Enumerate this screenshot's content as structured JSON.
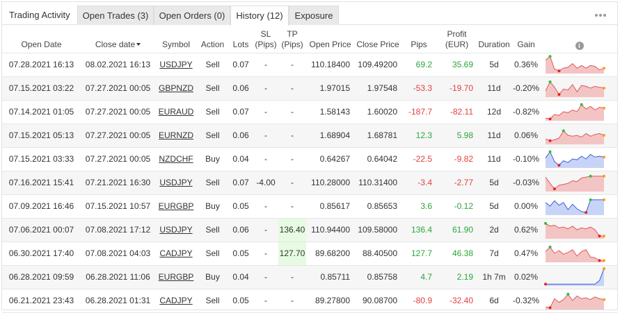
{
  "header": {
    "title": "Trading Activity",
    "tabs": [
      {
        "label": "Open Trades (3)",
        "active": false
      },
      {
        "label": "Open Orders (0)",
        "active": false
      },
      {
        "label": "History (12)",
        "active": true
      },
      {
        "label": "Exposure",
        "active": false
      }
    ],
    "more_icon": "ellipsis-icon"
  },
  "table": {
    "columns": {
      "open_date": "Open Date",
      "close_date": "Close date",
      "symbol": "Symbol",
      "action": "Action",
      "lots": "Lots",
      "sl_1": "SL",
      "sl_2": "(Pips)",
      "tp_1": "TP",
      "tp_2": "(Pips)",
      "open_price": "Open Price",
      "close_price": "Close Price",
      "pips": "Pips",
      "profit_1": "Profit",
      "profit_2": "(EUR)",
      "duration": "Duration",
      "gain": "Gain",
      "info_icon": "info-icon"
    },
    "rows": [
      {
        "open_date": "07.28.2021 16:13",
        "close_date": "08.02.2021 16:13",
        "symbol": "USDJPY",
        "action": "Sell",
        "lots": "0.07",
        "sl": "-",
        "tp": "-",
        "open_price": "110.18400",
        "close_price": "109.49200",
        "pips": "69.2",
        "profit": "35.69",
        "duration": "5d",
        "gain": "0.36%",
        "trend": "pos",
        "tp_hl": false,
        "spark": {
          "color": "red",
          "values": [
            0.75,
            0.95,
            0.25,
            0.15,
            0.3,
            0.35,
            0.55,
            0.3,
            0.45,
            0.3,
            0.45,
            0.4,
            0.2,
            0.3
          ]
        }
      },
      {
        "open_date": "07.15.2021 03:22",
        "close_date": "07.27.2021 00:05",
        "symbol": "GBPNZD",
        "action": "Sell",
        "lots": "0.06",
        "sl": "-",
        "tp": "-",
        "open_price": "1.97015",
        "close_price": "1.97548",
        "pips": "-53.3",
        "profit": "-19.70",
        "duration": "11d",
        "gain": "-0.20%",
        "trend": "neg",
        "tp_hl": false,
        "spark": {
          "color": "red",
          "values": [
            0.35,
            0.85,
            0.55,
            0.15,
            0.45,
            0.4,
            0.7,
            0.3,
            0.65,
            0.6,
            0.5,
            0.6,
            0.55,
            0.5
          ]
        }
      },
      {
        "open_date": "07.14.2021 01:05",
        "close_date": "07.27.2021 00:05",
        "symbol": "EURAUD",
        "action": "Sell",
        "lots": "0.07",
        "sl": "-",
        "tp": "-",
        "open_price": "1.58143",
        "close_price": "1.60020",
        "pips": "-187.7",
        "profit": "-82.11",
        "duration": "12d",
        "gain": "-0.82%",
        "trend": "neg",
        "tp_hl": false,
        "spark": {
          "color": "red",
          "values": [
            0.15,
            0.1,
            0.35,
            0.3,
            0.5,
            0.45,
            0.6,
            0.5,
            0.9,
            0.65,
            0.8,
            0.6,
            0.75,
            0.7
          ]
        }
      },
      {
        "open_date": "07.15.2021 05:13",
        "close_date": "07.27.2021 00:05",
        "symbol": "EURNZD",
        "action": "Sell",
        "lots": "0.06",
        "sl": "-",
        "tp": "-",
        "open_price": "1.68904",
        "close_price": "1.68781",
        "pips": "12.3",
        "profit": "5.98",
        "duration": "11d",
        "gain": "0.06%",
        "trend": "pos",
        "tp_hl": false,
        "spark": {
          "color": "red",
          "values": [
            0.3,
            0.2,
            0.25,
            0.35,
            0.75,
            0.5,
            0.45,
            0.5,
            0.4,
            0.6,
            0.45,
            0.55,
            0.6,
            0.5
          ]
        }
      },
      {
        "open_date": "07.15.2021 03:33",
        "close_date": "07.27.2021 00:05",
        "symbol": "NZDCHF",
        "action": "Buy",
        "lots": "0.04",
        "sl": "-",
        "tp": "-",
        "open_price": "0.64267",
        "close_price": "0.64042",
        "pips": "-22.5",
        "profit": "-9.82",
        "duration": "11d",
        "gain": "-0.10%",
        "trend": "neg",
        "tp_hl": false,
        "spark": {
          "color": "blue",
          "values": [
            0.55,
            0.9,
            0.35,
            0.15,
            0.4,
            0.3,
            0.5,
            0.45,
            0.65,
            0.5,
            0.75,
            0.6,
            0.65,
            0.6
          ]
        }
      },
      {
        "open_date": "07.16.2021 15:41",
        "close_date": "07.21.2021 16:30",
        "symbol": "USDJPY",
        "action": "Sell",
        "lots": "0.07",
        "sl": "-4.00",
        "tp": "-",
        "open_price": "110.28000",
        "close_price": "110.31400",
        "pips": "-3.4",
        "profit": "-2.77",
        "duration": "5d",
        "gain": "-0.03%",
        "trend": "neg",
        "tp_hl": false,
        "spark": {
          "color": "red",
          "values": [
            0.8,
            0.45,
            0.15,
            0.35,
            0.4,
            0.45,
            0.6,
            0.55,
            0.75,
            0.8,
            0.85,
            0.85,
            0.85,
            0.85
          ]
        }
      },
      {
        "open_date": "07.09.2021 16:46",
        "close_date": "07.15.2021 10:57",
        "symbol": "EURGBP",
        "action": "Buy",
        "lots": "0.05",
        "sl": "-",
        "tp": "-",
        "open_price": "0.85617",
        "close_price": "0.85653",
        "pips": "3.6",
        "profit": "-0.12",
        "duration": "5d",
        "gain": "0.00%",
        "trend": "pos",
        "tp_hl": false,
        "spark": {
          "color": "blue",
          "values": [
            0.7,
            0.5,
            0.8,
            0.55,
            0.7,
            0.3,
            0.6,
            0.35,
            0.2,
            0.15,
            0.85,
            0.85,
            0.85,
            0.85
          ]
        }
      },
      {
        "open_date": "07.06.2021 00:07",
        "close_date": "07.08.2021 17:12",
        "symbol": "USDJPY",
        "action": "Sell",
        "lots": "0.06",
        "sl": "-",
        "tp": "136.40",
        "open_price": "110.94400",
        "close_price": "109.58000",
        "pips": "136.4",
        "profit": "61.90",
        "duration": "2d",
        "gain": "0.62%",
        "trend": "pos",
        "tp_hl": true,
        "spark": {
          "color": "red",
          "values": [
            0.85,
            0.7,
            0.75,
            0.6,
            0.65,
            0.55,
            0.7,
            0.5,
            0.6,
            0.55,
            0.65,
            0.5,
            0.15,
            0.15
          ]
        }
      },
      {
        "open_date": "06.30.2021 17:40",
        "close_date": "07.08.2021 04:03",
        "symbol": "CADJPY",
        "action": "Sell",
        "lots": "0.05",
        "sl": "-",
        "tp": "127.70",
        "open_price": "89.68200",
        "close_price": "88.40500",
        "pips": "127.7",
        "profit": "46.38",
        "duration": "7d",
        "gain": "0.47%",
        "trend": "pos",
        "tp_hl": true,
        "spark": {
          "color": "red",
          "values": [
            0.6,
            0.85,
            0.5,
            0.65,
            0.45,
            0.55,
            0.7,
            0.35,
            0.6,
            0.7,
            0.3,
            0.25,
            0.1,
            0.1
          ]
        }
      },
      {
        "open_date": "06.28.2021 09:59",
        "close_date": "06.28.2021 11:06",
        "symbol": "EURGBP",
        "action": "Buy",
        "lots": "0.04",
        "sl": "-",
        "tp": "-",
        "open_price": "0.85711",
        "close_price": "0.85758",
        "pips": "4.7",
        "profit": "2.19",
        "duration": "1h 7m",
        "gain": "0.02%",
        "trend": "pos",
        "tp_hl": false,
        "spark": {
          "color": "blue",
          "values": [
            0.1,
            0.1,
            0.1,
            0.1,
            0.1,
            0.1,
            0.1,
            0.1,
            0.1,
            0.1,
            0.1,
            0.1,
            0.3,
            0.95
          ]
        }
      },
      {
        "open_date": "06.21.2021 23:43",
        "close_date": "06.28.2021 01:31",
        "symbol": "CADJPY",
        "action": "Sell",
        "lots": "0.05",
        "sl": "-",
        "tp": "-",
        "open_price": "89.27800",
        "close_price": "90.08700",
        "pips": "-80.9",
        "profit": "-32.40",
        "duration": "6d",
        "gain": "-0.32%",
        "trend": "neg",
        "tp_hl": false,
        "spark": {
          "color": "red",
          "values": [
            0.15,
            0.1,
            0.6,
            0.4,
            0.55,
            0.85,
            0.5,
            0.75,
            0.6,
            0.65,
            0.55,
            0.7,
            0.6,
            0.55
          ]
        }
      }
    ]
  },
  "colors": {
    "positive": "#2aa63a",
    "negative": "#e2403c",
    "tp_highlight": "#e6fbe1",
    "spark_red_line": "#e05858",
    "spark_red_fill": "#f3c4c4",
    "spark_blue_line": "#3a5fd9",
    "spark_blue_fill": "#c8d4f7",
    "spark_start_dot": "#2fbf3a",
    "spark_end_dot": "#ff9d1f",
    "spark_low_dot": "#e5231f"
  }
}
